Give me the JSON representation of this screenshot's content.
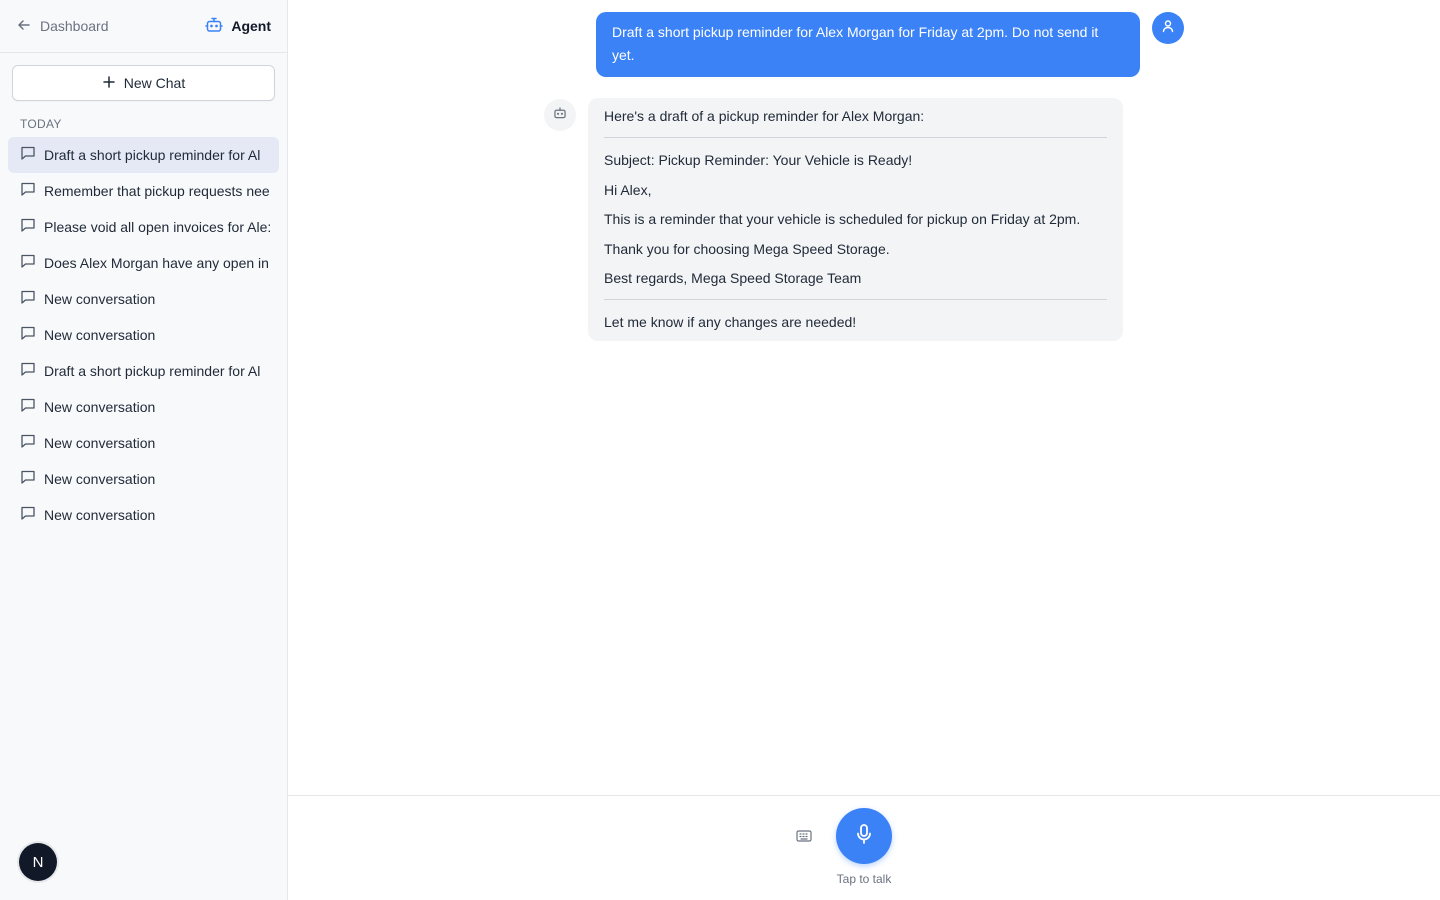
{
  "header": {
    "back_label": "Dashboard",
    "title": "Agent"
  },
  "sidebar": {
    "new_chat_label": "New Chat",
    "section_label": "TODAY",
    "conversations": [
      {
        "label": "Draft a short pickup reminder for Al",
        "active": true
      },
      {
        "label": "Remember that pickup requests nee",
        "active": false
      },
      {
        "label": "Please void all open invoices for Ale:",
        "active": false
      },
      {
        "label": "Does Alex Morgan have any open in",
        "active": false
      },
      {
        "label": "New conversation",
        "active": false
      },
      {
        "label": "New conversation",
        "active": false
      },
      {
        "label": "Draft a short pickup reminder for Al",
        "active": false
      },
      {
        "label": "New conversation",
        "active": false
      },
      {
        "label": "New conversation",
        "active": false
      },
      {
        "label": "New conversation",
        "active": false
      },
      {
        "label": "New conversation",
        "active": false
      }
    ],
    "user_initial": "N"
  },
  "chat": {
    "user_message": "Draft a short pickup reminder for Alex Morgan for Friday at 2pm. Do not send it yet.",
    "assistant": {
      "intro": "Here's a draft of a pickup reminder for Alex Morgan:",
      "draft_lines": [
        "Subject: Pickup Reminder: Your Vehicle is Ready!",
        "Hi Alex,",
        "This is a reminder that your vehicle is scheduled for pickup on Friday at 2pm.",
        "Thank you for choosing Mega Speed Storage.",
        "Best regards, Mega Speed Storage Team"
      ],
      "outro": "Let me know if any changes are needed!"
    }
  },
  "footer": {
    "tap_label": "Tap to talk"
  },
  "colors": {
    "accent": "#3b82f6",
    "active_item_bg": "#e5e9f6",
    "sidebar_bg": "#f8f9fb"
  }
}
